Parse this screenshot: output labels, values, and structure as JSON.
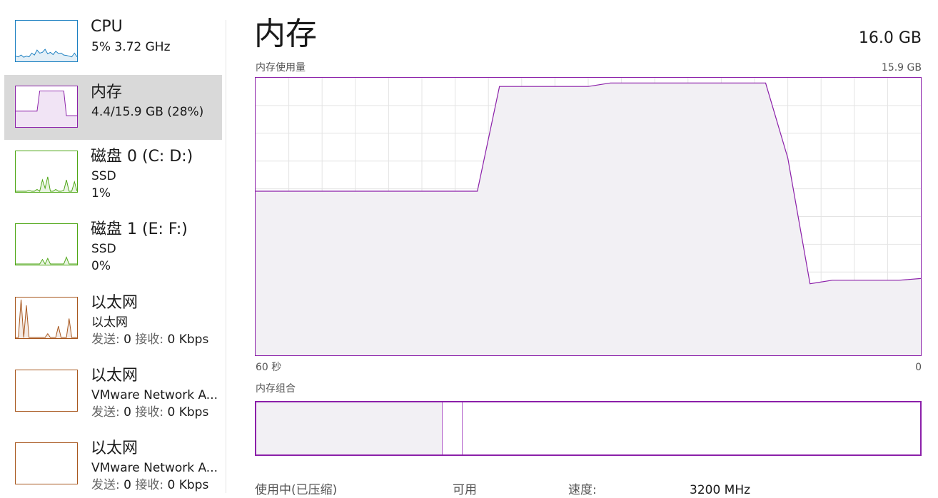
{
  "sidebar": {
    "items": [
      {
        "title": "CPU",
        "line1": "5%  3.72 GHz",
        "color": "#1a7fc1",
        "trace": [
          0.12,
          0.1,
          0.15,
          0.09,
          0.12,
          0.1,
          0.2,
          0.15,
          0.28,
          0.2,
          0.22,
          0.3,
          0.18,
          0.22,
          0.16,
          0.25,
          0.19,
          0.2,
          0.15,
          0.14,
          0.12,
          0.1,
          0.2,
          0.1
        ]
      },
      {
        "title": "内存",
        "line1": "4.4/15.9 GB (28%)",
        "color": "#8b1fa9",
        "selected": true,
        "trace": [
          0.4,
          0.4,
          0.4,
          0.4,
          0.4,
          0.4,
          0.4,
          0.4,
          0.4,
          0.93,
          0.93,
          0.93,
          0.93,
          0.93,
          0.93,
          0.93,
          0.93,
          0.93,
          0.93,
          0.28,
          0.28,
          0.28,
          0.28,
          0.28
        ]
      },
      {
        "title": "磁盘 0 (C: D:)",
        "line1": "SSD",
        "line2": "1%",
        "color": "#4da614",
        "trace": [
          0,
          0,
          0,
          0,
          0,
          0.02,
          0,
          0,
          0.05,
          0,
          0.3,
          0.08,
          0.38,
          0,
          0,
          0.05,
          0,
          0,
          0.02,
          0.3,
          0,
          0,
          0.25,
          0
        ]
      },
      {
        "title": "磁盘 1 (E: F:)",
        "line1": "SSD",
        "line2": "0%",
        "color": "#4da614",
        "trace": [
          0,
          0,
          0,
          0,
          0,
          0,
          0,
          0,
          0,
          0,
          0.12,
          0,
          0.15,
          0,
          0,
          0,
          0,
          0,
          0,
          0.18,
          0,
          0,
          0,
          0
        ]
      },
      {
        "title": "以太网",
        "line1": "以太网",
        "sendLabel": "发送:",
        "sendVal": "0",
        "recvLabel": "接收:",
        "recvVal": "0 Kbps",
        "color": "#a7561d",
        "trace": [
          0,
          0,
          1.0,
          0,
          0.85,
          0,
          0,
          0,
          0,
          0,
          0,
          0,
          0.1,
          0,
          0,
          0,
          0.3,
          0,
          0,
          0,
          0.5,
          0,
          0,
          0
        ]
      },
      {
        "title": "以太网",
        "line1": "VMware Network A...",
        "sendLabel": "发送:",
        "sendVal": "0",
        "recvLabel": "接收:",
        "recvVal": "0 Kbps",
        "color": "#a7561d",
        "trace": []
      },
      {
        "title": "以太网",
        "line1": "VMware Network A...",
        "sendLabel": "发送:",
        "sendVal": "0",
        "recvLabel": "接收:",
        "recvVal": "0 Kbps",
        "color": "#a7561d",
        "trace": []
      }
    ]
  },
  "main": {
    "title": "内存",
    "total": "16.0 GB",
    "usage_label": "内存使用量",
    "usage_max": "15.9 GB",
    "axis_left": "60 秒",
    "axis_right": "0",
    "composition_label": "内存组合",
    "stats": {
      "in_use": "使用中(已压缩)",
      "available": "可用",
      "speed_label": "速度:",
      "speed_value": "3200 MHz"
    }
  },
  "colors": {
    "accent": "#8b1fa9",
    "fill": "#f2f0f4",
    "grid": "#e4e4e4",
    "selected_bg": "#d9d9d9"
  },
  "chart_data": {
    "type": "area",
    "title": "内存使用量",
    "x_range": [
      60,
      0
    ],
    "ylim": [
      0,
      15.9
    ],
    "unit": "GB",
    "x_seconds_ago": [
      60,
      58,
      56,
      54,
      52,
      50,
      48,
      46,
      44,
      42,
      40,
      38,
      36,
      34,
      32,
      30,
      28,
      26,
      24,
      22,
      20,
      18,
      16,
      14,
      12,
      10,
      8,
      6,
      4,
      2,
      0
    ],
    "values": [
      9.4,
      9.4,
      9.4,
      9.4,
      9.4,
      9.4,
      9.4,
      9.4,
      9.4,
      9.4,
      9.4,
      15.4,
      15.4,
      15.4,
      15.4,
      15.4,
      15.6,
      15.6,
      15.6,
      15.6,
      15.6,
      15.6,
      15.6,
      15.6,
      11.3,
      4.1,
      4.3,
      4.3,
      4.3,
      4.3,
      4.4
    ]
  },
  "composition": {
    "in_use_fraction": 0.28,
    "modified_fraction": 0.03
  }
}
